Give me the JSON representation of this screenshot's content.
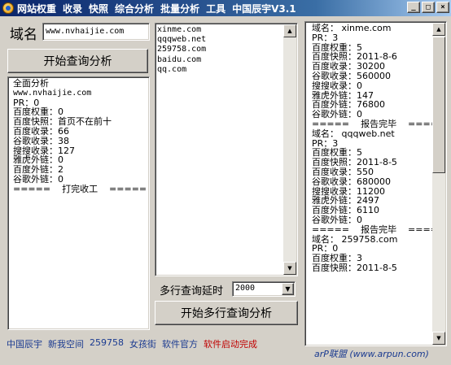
{
  "titlebar": {
    "menu": [
      "网站权重",
      "收录",
      "快照",
      "综合分析",
      "批量分析",
      "工具",
      "中国辰宇V3.1"
    ],
    "minimize_symbol": "_",
    "maximize_symbol": "□",
    "close_symbol": "×",
    "icon": "orb-icon"
  },
  "left": {
    "domain_label": "域名",
    "domain_value": "www.nvhaijie.com",
    "analyze_button": "开始查询分析",
    "result_lines": [
      "全面分析",
      "www.nvhaijie.com",
      "",
      "PR：0",
      "百度权重：0",
      "百度快照：首页不在前十",
      "百度收录：66",
      "谷歌收录：38",
      "搜搜收录：127",
      "雅虎外链：0",
      "百度外链：2",
      "谷歌外链：0",
      "",
      "=====    打完收工    ====="
    ]
  },
  "middle": {
    "domains": [
      "xinme.com",
      "qqqweb.net",
      "259758.com",
      "baidu.com",
      "qq.com"
    ],
    "delay_label": "多行查询延时",
    "delay_value": "2000",
    "multi_button": "开始多行查询分析"
  },
  "right": {
    "report_lines": [
      "域名： xinme.com",
      "",
      "PR：3",
      "百度权重：5",
      "百度快照：2011-8-6",
      "百度收录：30200",
      "谷歌收录：560000",
      "搜搜收录：0",
      "雅虎外链：147",
      "百度外链：76800",
      "谷歌外链：0",
      "",
      "=====    报告完毕    =====",
      "",
      "域名： qqqweb.net",
      "",
      "PR：3",
      "百度权重：5",
      "百度快照：2011-8-5",
      "百度收录：550",
      "谷歌收录：680000",
      "搜搜收录：11200",
      "雅虎外链：2497",
      "百度外链：6110",
      "谷歌外链：0",
      "",
      "=====    报告完毕    =====",
      "",
      "域名： 259758.com",
      "",
      "PR：0",
      "百度权重：3",
      "百度快照：2011-8-5"
    ]
  },
  "footer": {
    "links": [
      {
        "text": "中国辰宇",
        "color": "#1a3a90"
      },
      {
        "text": "新我空间",
        "color": "#1a3a90"
      },
      {
        "text": "259758",
        "color": "#1a3a90"
      },
      {
        "text": "女孩街",
        "color": "#1a3a90"
      },
      {
        "text": "软件官方",
        "color": "#1a3a90"
      }
    ],
    "status": {
      "text": "软件启动完成",
      "color": "#c00000"
    },
    "watermark": "arP联盟 (www.arpun.com)"
  }
}
